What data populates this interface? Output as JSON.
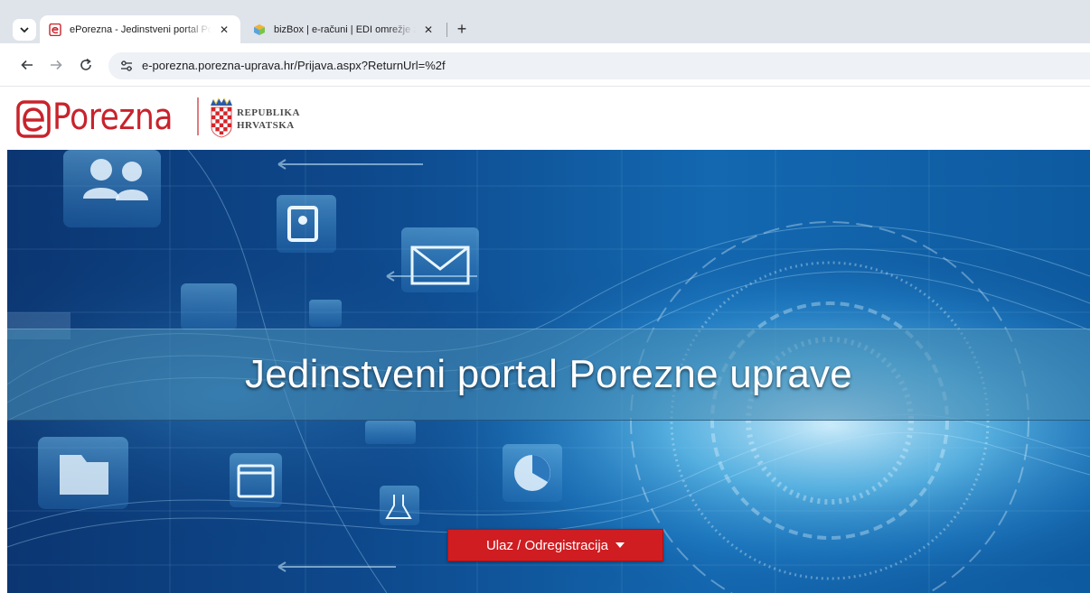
{
  "browser": {
    "tabs": [
      {
        "title": "ePorezna - Jedinstveni portal Porezne uprave",
        "active": true
      },
      {
        "title": "bizBox | e-računi | EDI omrežje za e-poslovanje",
        "active": false
      }
    ],
    "new_tab_label": "+",
    "close_label": "✕",
    "address": "e-porezna.porezna-uprava.hr/Prijava.aspx?ReturnUrl=%2f"
  },
  "header": {
    "logo_text": "Porezna",
    "republic_line1": "REPUBLIKA",
    "republic_line2": "HRVATSKA"
  },
  "hero": {
    "title": "Jedinstveni portal Porezne uprave",
    "login_button": "Ulaz / Odregistracija"
  },
  "colors": {
    "brand_red": "#c8232c",
    "button_red": "#cf1d22",
    "hero_blue": "#0a3a78"
  },
  "icons": [
    "chevron-down-icon",
    "back-arrow-icon",
    "forward-arrow-icon",
    "reload-icon",
    "site-info-icon",
    "caret-down-icon"
  ]
}
